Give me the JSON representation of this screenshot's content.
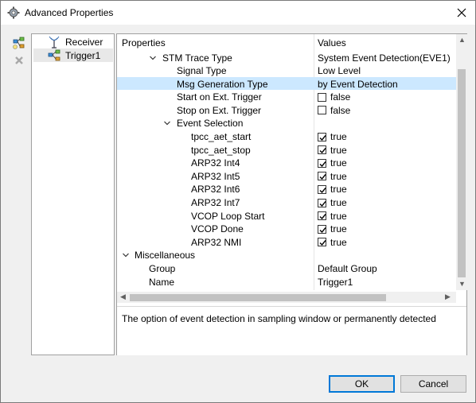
{
  "window": {
    "title": "Advanced Properties"
  },
  "tree": {
    "items": [
      {
        "label": "Receiver",
        "icon": "receiver-antenna-icon"
      },
      {
        "label": "Trigger1",
        "icon": "trigger-node-icon"
      }
    ]
  },
  "properties": {
    "headers": {
      "property": "Properties",
      "value": "Values"
    },
    "rows": [
      {
        "label": "STM Trace Type",
        "value": "System Event Detection(EVE1)",
        "expander": "down"
      },
      {
        "label": "Signal Type",
        "value": "Low Level"
      },
      {
        "label": "Msg Generation Type",
        "value": "by Event Detection"
      },
      {
        "label": "Start on Ext. Trigger",
        "value": "false",
        "checked": false
      },
      {
        "label": "Stop on Ext. Trigger",
        "value": "false",
        "checked": false
      },
      {
        "label": "Event Selection",
        "value": "",
        "expander": "down"
      },
      {
        "label": "tpcc_aet_start",
        "value": "true",
        "checked": true
      },
      {
        "label": "tpcc_aet_stop",
        "value": "true",
        "checked": true
      },
      {
        "label": "ARP32 Int4",
        "value": "true",
        "checked": true
      },
      {
        "label": "ARP32 Int5",
        "value": "true",
        "checked": true
      },
      {
        "label": "ARP32 Int6",
        "value": "true",
        "checked": true
      },
      {
        "label": "ARP32 Int7",
        "value": "true",
        "checked": true
      },
      {
        "label": "VCOP Loop Start",
        "value": "true",
        "checked": true
      },
      {
        "label": "VCOP Done",
        "value": "true",
        "checked": true
      },
      {
        "label": "ARP32 NMI",
        "value": "true",
        "checked": true
      },
      {
        "label": "Miscellaneous",
        "value": "",
        "expander": "down"
      },
      {
        "label": "Group",
        "value": "Default Group"
      },
      {
        "label": "Name",
        "value": "Trigger1"
      }
    ]
  },
  "description": "The option of event detection in sampling window or permanently detected",
  "buttons": {
    "ok": "OK",
    "cancel": "Cancel"
  }
}
